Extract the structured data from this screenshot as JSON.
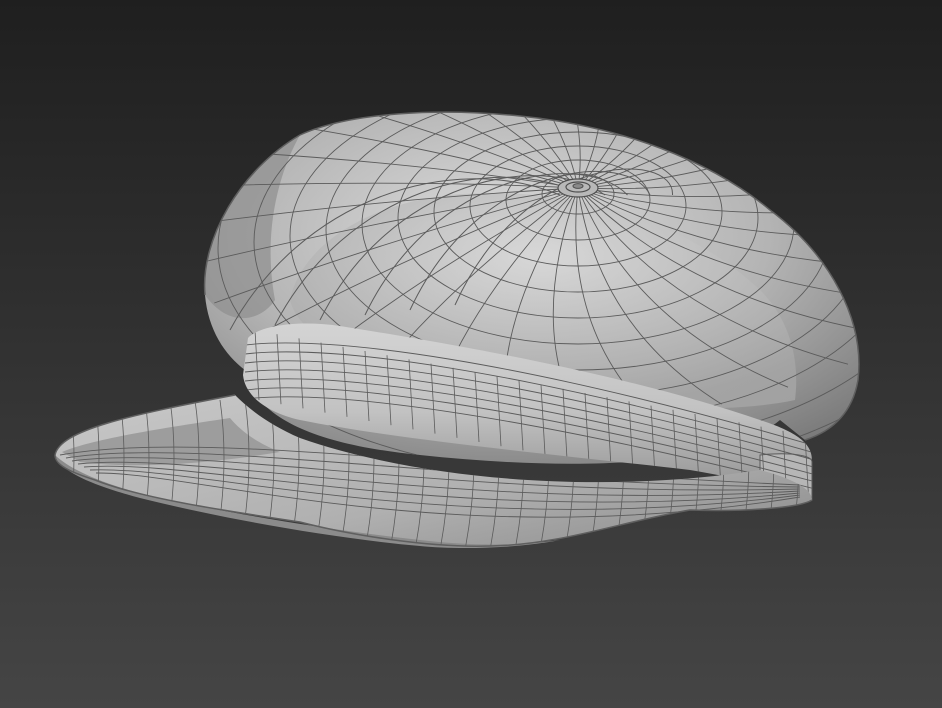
{
  "viewport": {
    "render_mode": "shaded-with-wireframe",
    "background_top_color": "#1f1f1f",
    "background_bottom_color": "#454545",
    "wire_color": "#5b5b5b",
    "surface_light_color": "#d6d6d6",
    "surface_dark_color": "#7c7c7c"
  },
  "model": {
    "object": "newsboy cap",
    "parts": [
      "crown",
      "crown-button",
      "band",
      "visor"
    ]
  }
}
